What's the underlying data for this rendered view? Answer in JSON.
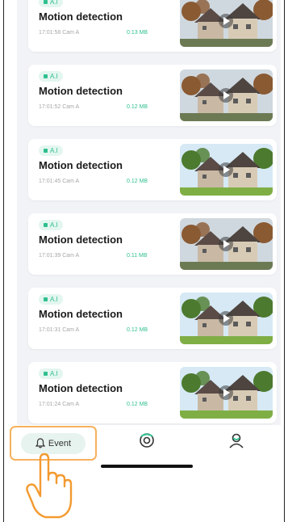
{
  "events": [
    {
      "tag": "A.I",
      "title": "Motion detection",
      "meta": "17:01:58 Cam A",
      "size": "0.13 MB",
      "scene": "autumn"
    },
    {
      "tag": "A.I",
      "title": "Motion detection",
      "meta": "17:01:52 Cam A",
      "size": "0.12 MB",
      "scene": "autumn"
    },
    {
      "tag": "A.I",
      "title": "Motion detection",
      "meta": "17:01:45 Cam A",
      "size": "0.12 MB",
      "scene": "summer"
    },
    {
      "tag": "A.I",
      "title": "Motion detection",
      "meta": "17:01:39 Cam A",
      "size": "0.11 MB",
      "scene": "autumn"
    },
    {
      "tag": "A.I",
      "title": "Motion detection",
      "meta": "17:01:31 Cam A",
      "size": "0.12 MB",
      "scene": "summer"
    },
    {
      "tag": "A.I",
      "title": "Motion detection",
      "meta": "17:01:24 Cam A",
      "size": "0.12 MB",
      "scene": "summer"
    }
  ],
  "tabs": {
    "event_label": "Event",
    "event_icon": "bell-icon",
    "center_icon": "camera-icon",
    "right_icon": "user-icon"
  },
  "colors": {
    "accent": "#2fbf8e",
    "highlight": "#f6b15d",
    "hand": "#f39a30"
  }
}
